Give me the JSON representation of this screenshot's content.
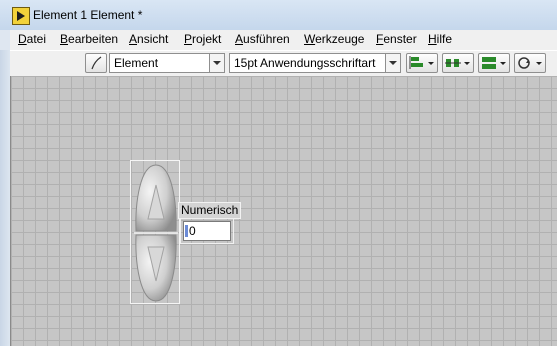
{
  "window": {
    "title": "Element 1 Element *"
  },
  "menu": {
    "items": [
      {
        "label": "Datei",
        "accel": "D"
      },
      {
        "label": "Bearbeiten",
        "accel": "B"
      },
      {
        "label": "Ansicht",
        "accel": "A"
      },
      {
        "label": "Projekt",
        "accel": "P"
      },
      {
        "label": "Ausführen",
        "accel": "A"
      },
      {
        "label": "Werkzeuge",
        "accel": "W"
      },
      {
        "label": "Fenster",
        "accel": "F"
      },
      {
        "label": "Hilfe",
        "accel": "H"
      }
    ]
  },
  "toolbar": {
    "element_select": "Element",
    "font_select": "15pt Anwendungsschriftart"
  },
  "control": {
    "label": "Numerisch",
    "value": "0"
  }
}
